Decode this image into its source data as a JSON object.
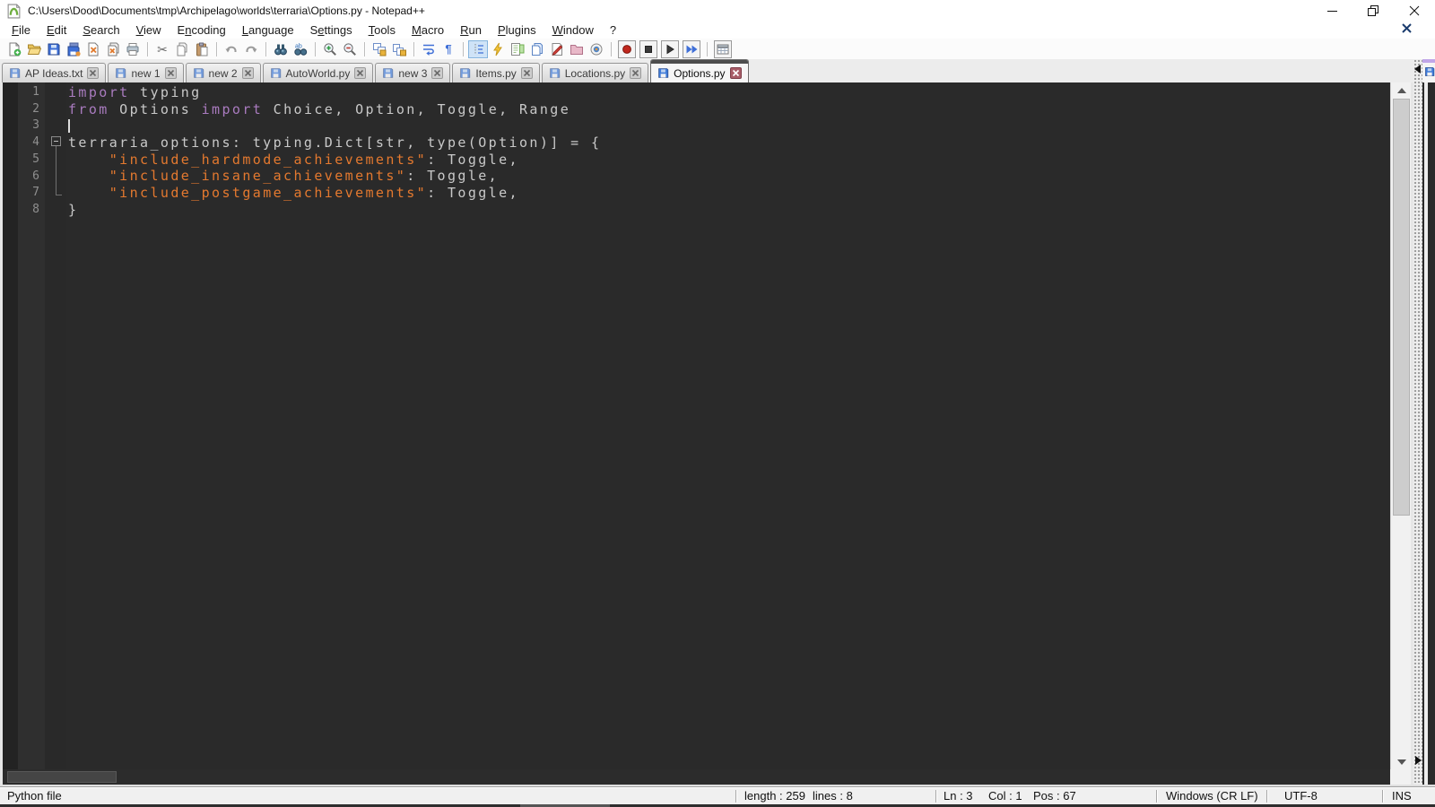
{
  "window": {
    "title": "C:\\Users\\Dood\\Documents\\tmp\\Archipelago\\worlds\\terraria\\Options.py - Notepad++"
  },
  "menu": {
    "items": [
      {
        "label": "File",
        "u": 0
      },
      {
        "label": "Edit",
        "u": 0
      },
      {
        "label": "Search",
        "u": 0
      },
      {
        "label": "View",
        "u": 0
      },
      {
        "label": "Encoding",
        "u": 1
      },
      {
        "label": "Language",
        "u": 0
      },
      {
        "label": "Settings",
        "u": 1
      },
      {
        "label": "Tools",
        "u": 0
      },
      {
        "label": "Macro",
        "u": 0
      },
      {
        "label": "Run",
        "u": 0
      },
      {
        "label": "Plugins",
        "u": 0
      },
      {
        "label": "Window",
        "u": 0
      },
      {
        "label": "?",
        "u": -1
      }
    ]
  },
  "toolbar": {
    "icons": [
      {
        "name": "new-file"
      },
      {
        "name": "open-file"
      },
      {
        "name": "save-file"
      },
      {
        "name": "save-all"
      },
      {
        "name": "close-file"
      },
      {
        "name": "close-all"
      },
      {
        "name": "print"
      },
      {
        "sep": true
      },
      {
        "name": "cut"
      },
      {
        "name": "copy"
      },
      {
        "name": "paste"
      },
      {
        "sep": true
      },
      {
        "name": "undo"
      },
      {
        "name": "redo"
      },
      {
        "sep": true
      },
      {
        "name": "find"
      },
      {
        "name": "replace"
      },
      {
        "sep": true
      },
      {
        "name": "zoom-in"
      },
      {
        "name": "zoom-out"
      },
      {
        "sep": true
      },
      {
        "name": "sync-vertical-scrolling"
      },
      {
        "name": "sync-horizontal-scrolling"
      },
      {
        "sep": true
      },
      {
        "name": "word-wrap"
      },
      {
        "name": "show-all-characters"
      },
      {
        "sep": true
      },
      {
        "name": "indent-guide",
        "pressed": true
      },
      {
        "name": "function-list"
      },
      {
        "name": "document-map"
      },
      {
        "name": "document-switcher"
      },
      {
        "name": "edit-marker"
      },
      {
        "name": "project-panel"
      },
      {
        "name": "file-monitor"
      },
      {
        "sep": true
      },
      {
        "name": "record-macro",
        "boxed": true
      },
      {
        "name": "stop-macro",
        "boxed": true
      },
      {
        "name": "play-macro",
        "boxed": true
      },
      {
        "name": "run-macro-multiple",
        "boxed": true
      },
      {
        "sep": true
      },
      {
        "name": "save-macro",
        "boxed": true
      }
    ]
  },
  "tabbar": {
    "tabs": [
      {
        "label": "AP Ideas.txt",
        "active": false
      },
      {
        "label": "new 1",
        "active": false
      },
      {
        "label": "new 2",
        "active": false
      },
      {
        "label": "AutoWorld.py",
        "active": false
      },
      {
        "label": "new 3",
        "active": false
      },
      {
        "label": "Items.py",
        "active": false
      },
      {
        "label": "Locations.py",
        "active": false
      },
      {
        "label": "Options.py",
        "active": true
      }
    ]
  },
  "editor": {
    "colors": {
      "keyword": "#a97bbf",
      "default": "#c9c9c9",
      "string": "#e4792f",
      "background": "#2a2a2a",
      "gutter_bg": "#2f2f2f",
      "line_number": "#8f8f8f"
    },
    "lines": [
      {
        "num": 1,
        "segs": [
          [
            "k",
            "import"
          ],
          [
            "d",
            " typing"
          ]
        ]
      },
      {
        "num": 2,
        "segs": [
          [
            "k",
            "from"
          ],
          [
            "d",
            " Options "
          ],
          [
            "k",
            "import"
          ],
          [
            "d",
            " Choice, Option, Toggle, Range"
          ]
        ]
      },
      {
        "num": 3,
        "segs": [],
        "cursor": true
      },
      {
        "num": 4,
        "segs": [
          [
            "d",
            "terraria_options: typing.Dict[str, type(Option)] = {"
          ]
        ],
        "fold": "open"
      },
      {
        "num": 5,
        "segs": [
          [
            "d",
            "    "
          ],
          [
            "s",
            "\"include_hardmode_achievements\""
          ],
          [
            "d",
            ": Toggle,"
          ]
        ]
      },
      {
        "num": 6,
        "segs": [
          [
            "d",
            "    "
          ],
          [
            "s",
            "\"include_insane_achievements\""
          ],
          [
            "d",
            ": Toggle,"
          ]
        ]
      },
      {
        "num": 7,
        "segs": [
          [
            "d",
            "    "
          ],
          [
            "s",
            "\"include_postgame_achievements\""
          ],
          [
            "d",
            ": Toggle,"
          ]
        ],
        "fold_end": true
      },
      {
        "num": 8,
        "segs": [
          [
            "d",
            "}"
          ]
        ]
      }
    ]
  },
  "status": {
    "doc_type": "Python file",
    "length": "length : 259",
    "lines": "lines : 8",
    "ln": "Ln : 3",
    "col": "Col : 1",
    "pos": "Pos : 67",
    "eol": "Windows (CR LF)",
    "encoding": "UTF-8",
    "insert_mode": "INS"
  }
}
